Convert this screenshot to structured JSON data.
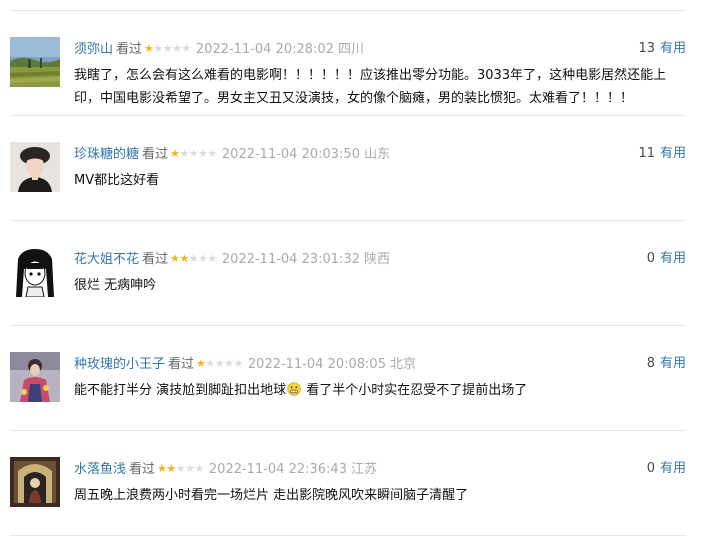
{
  "comments": [
    {
      "user": "须弥山",
      "status": "看过",
      "rating": 1,
      "time": "2022-11-04 20:28:02",
      "location": "四川",
      "votes": "13",
      "useful_label": "有用",
      "content_parts": [
        "我瞎了，怎么会有这么难看的电影啊！！！！！！应该推出零分功能。3033年了，这种电影居然还能上印，中国电影没希望了。男女主又丑又没演技，女的像个脑瘫，男的装比惯犯。太难看了！！！！"
      ]
    },
    {
      "user": "珍珠糖的糖",
      "status": "看过",
      "rating": 1,
      "time": "2022-11-04 20:03:50",
      "location": "山东",
      "votes": "11",
      "useful_label": "有用",
      "content_parts": [
        "MV都比这好看"
      ]
    },
    {
      "user": "花大姐不花",
      "status": "看过",
      "rating": 2,
      "time": "2022-11-04 23:01:32",
      "location": "陕西",
      "votes": "0",
      "useful_label": "有用",
      "content_parts": [
        "很烂 无病呻吟"
      ]
    },
    {
      "user": "种玫瑰的小王子",
      "status": "看过",
      "rating": 1,
      "time": "2022-11-04 20:08:05",
      "location": "北京",
      "votes": "8",
      "useful_label": "有用",
      "content_parts": [
        "能不能打半分 演技尬到脚趾扣出地球",
        " 看了半个小时实在忍受不了提前出场了"
      ]
    },
    {
      "user": "水落鱼浅",
      "status": "看过",
      "rating": 2,
      "time": "2022-11-04 22:36:43",
      "location": "江苏",
      "votes": "0",
      "useful_label": "有用",
      "content_parts": [
        "周五晚上浪费两小时看完一场烂片 走出影院晚风吹来瞬间脑子清醒了"
      ]
    }
  ],
  "colors": {
    "link": "#3377aa",
    "star_on": "#f7b21a",
    "star_off": "#dcdcdc",
    "meta": "#aaaaaa",
    "divider": "#e6e6e6"
  },
  "icons": {
    "embarrassed_emoji": "grimace-emoji-icon",
    "star": "star-icon"
  }
}
